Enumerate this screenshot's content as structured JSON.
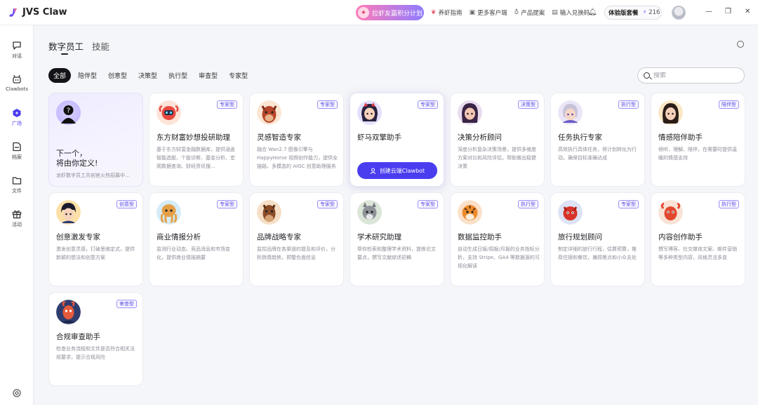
{
  "app": {
    "name": "JVS Claw"
  },
  "topbar": {
    "promo_label": "拉虾友赢积分计划",
    "links": [
      {
        "icon": "shrimp-icon",
        "label": "养虾指南"
      },
      {
        "icon": "grid-icon",
        "label": "更多客户端"
      },
      {
        "icon": "bulb-icon",
        "label": "产品提案"
      },
      {
        "icon": "ticket-icon",
        "label": "输入兑换码"
      }
    ],
    "plan_label": "体验版套餐",
    "credits": "216"
  },
  "sidebar": {
    "items": [
      {
        "label": "对话",
        "icon": "chat-icon"
      },
      {
        "label": "Clawbots",
        "icon": "robot-icon"
      },
      {
        "label": "广场",
        "icon": "plaza-icon",
        "active": true
      },
      {
        "label": "档案",
        "icon": "archive-icon"
      },
      {
        "label": "文件",
        "icon": "folder-icon"
      },
      {
        "label": "活动",
        "icon": "gift-icon"
      }
    ]
  },
  "page": {
    "tabs": [
      {
        "label": "数字员工",
        "active": true
      },
      {
        "label": "技能"
      }
    ],
    "filters": [
      "全部",
      "陪伴型",
      "创意型",
      "决策型",
      "执行型",
      "审查型",
      "专家型"
    ],
    "search_placeholder": "搜索"
  },
  "custom_card": {
    "title_line1": "下一个，",
    "title_line2": "将由你定义!",
    "desc": "龙虾数字员工共创官火热招募中..."
  },
  "cards": [
    {
      "title": "东方财富妙想投研助理",
      "badge": "专家型",
      "desc": "基于东方财富金融数据库，提供涵盖智能选股、个股诊断、基金分析、宏观数据查询、财经资讯搜..."
    },
    {
      "title": "灵感智造专家",
      "badge": "专家型",
      "desc": "融合 Wan2.7 图像引擎与 HappyHorse 视频创作能力，提供全链路、多模态的 AIGC 创意助理服务"
    },
    {
      "title": "虾马双擎助手",
      "badge": "专家型",
      "button": "创建云端Clawbot"
    },
    {
      "title": "决策分析顾问",
      "badge": "决策型",
      "desc": "深度分析复杂决策场景，提供多维度方案对比和风险评估，帮助做出稳健决策"
    },
    {
      "title": "任务执行专家",
      "badge": "执行型",
      "desc": "高效执行具体任务，将计划转化为行动，确保目标准确达成"
    },
    {
      "title": "情感陪伴助手",
      "badge": "陪伴型",
      "desc": "倾听、理解、陪伴，在需要时提供温暖的情感支持"
    },
    {
      "title": "创意激发专家",
      "badge": "创意型",
      "desc": "激发创意灵感，打破思维定式，提供新颖的想法和创意方案"
    },
    {
      "title": "商业情报分析",
      "badge": "专家型",
      "desc": "监测行业动态、竞品消息和市场变化，提供商业情报摘要"
    },
    {
      "title": "品牌战略专家",
      "badge": "专家型",
      "desc": "监控品牌在各渠道的提及和评价，分析舆情趋势，预警负面信息"
    },
    {
      "title": "学术研究助理",
      "badge": "专家型",
      "desc": "帮你检索和整理学术资料，提炼论文要点，撰写文献综述初稿"
    },
    {
      "title": "数据监控助手",
      "badge": "执行型",
      "desc": "自动生成日报/周报/月报的业务指标分析，支持 Stripe、GA4 等数据源的可视化解读"
    },
    {
      "title": "旅行规划顾问",
      "badge": "专家型",
      "desc": "制定详细的旅行行程，估算预算，推荐住宿和餐饮，兼顾景点和小众去处"
    },
    {
      "title": "内容创作助手",
      "badge": "执行型",
      "desc": "撰写博客、社交媒体文案、邮件营销等多种类型内容，风格灵活多变"
    },
    {
      "title": "合规审查助手",
      "badge": "审查型",
      "desc": "检查业务流程和文件是否符合相关法规要求，提示合规风险"
    }
  ]
}
